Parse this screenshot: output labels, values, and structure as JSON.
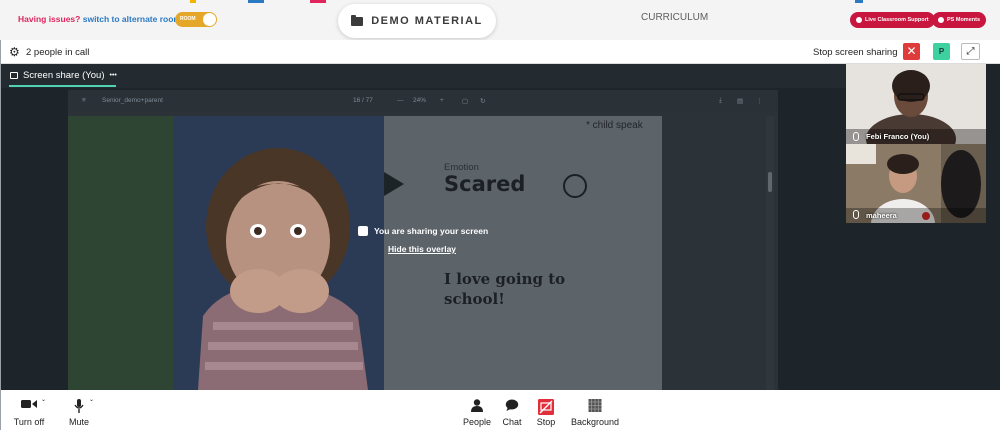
{
  "topbar": {
    "issues_question": "Having issues?",
    "issues_link": "switch to alternate room",
    "room_toggle": "ROOM",
    "demo_material": "DEMO MATERIAL",
    "curriculum": "CURRICULUM",
    "live_support": "Live Classroom Support",
    "ps_moments": "PS Moments"
  },
  "call": {
    "people_count": "2 people in call",
    "stop_sharing": "Stop screen sharing",
    "presenter_badge": "P",
    "tab_label": "Screen share (You)",
    "tab_more": "•••"
  },
  "pdf": {
    "filename": "Senior_demo+parent",
    "page": "16 / 77",
    "zoom": "24%",
    "minus": "—",
    "plus": "+"
  },
  "slide": {
    "child_speak": "* child speak",
    "emotion": "Emotion",
    "title": "Scared",
    "sentence": "I love going to school!"
  },
  "overlay": {
    "message": "You are sharing your screen",
    "hide_link": "Hide this overlay"
  },
  "participants": [
    {
      "name": "Febi Franco (You)"
    },
    {
      "name": "maheera"
    }
  ],
  "controls": {
    "turn_off": "Turn off",
    "mute": "Mute",
    "people": "People",
    "chat": "Chat",
    "stop": "Stop",
    "background": "Background"
  },
  "colors": {
    "accent_red": "#c8163f",
    "tab_underline": "#4fd3b2",
    "room_toggle": "#e5a72a",
    "stage_bg": "#1e252a"
  }
}
